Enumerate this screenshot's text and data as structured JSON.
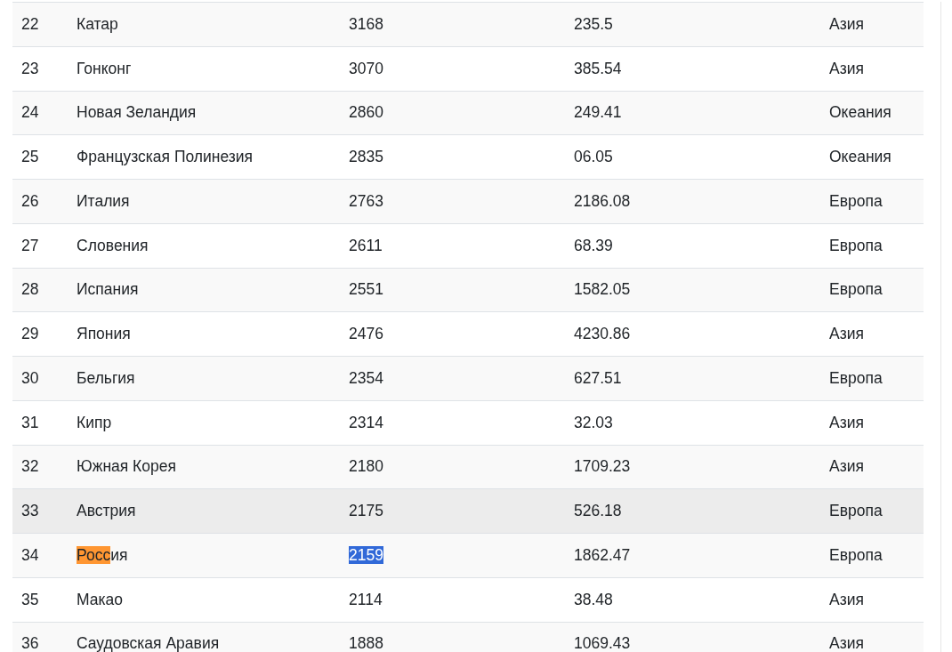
{
  "table": {
    "rows": [
      {
        "hovered": false,
        "cells": [
          "22",
          "Катар",
          "3168",
          "235.5",
          "Азия"
        ]
      },
      {
        "hovered": false,
        "cells": [
          "23",
          "Гонконг",
          "3070",
          "385.54",
          "Азия"
        ]
      },
      {
        "hovered": false,
        "cells": [
          "24",
          "Новая Зеландия",
          "2860",
          "249.41",
          "Океания"
        ]
      },
      {
        "hovered": false,
        "cells": [
          "25",
          "Французская Полинезия",
          "2835",
          "06.05",
          "Океания"
        ]
      },
      {
        "hovered": false,
        "cells": [
          "26",
          "Италия",
          "2763",
          "2186.08",
          "Европа"
        ]
      },
      {
        "hovered": false,
        "cells": [
          "27",
          "Словения",
          "2611",
          "68.39",
          "Европа"
        ]
      },
      {
        "hovered": false,
        "cells": [
          "28",
          "Испания",
          "2551",
          "1582.05",
          "Европа"
        ]
      },
      {
        "hovered": false,
        "cells": [
          "29",
          "Япония",
          "2476",
          "4230.86",
          "Азия"
        ]
      },
      {
        "hovered": false,
        "cells": [
          "30",
          "Бельгия",
          "2354",
          "627.51",
          "Европа"
        ]
      },
      {
        "hovered": false,
        "cells": [
          "31",
          "Кипр",
          "2314",
          "32.03",
          "Азия"
        ]
      },
      {
        "hovered": false,
        "cells": [
          "32",
          "Южная Корея",
          "2180",
          "1709.23",
          "Азия"
        ]
      },
      {
        "hovered": true,
        "cells": [
          "33",
          "Австрия",
          "2175",
          "526.18",
          "Европа"
        ]
      },
      {
        "hovered": false,
        "cells": [
          "34",
          {
            "parts": [
              {
                "text": "Росс",
                "highlighted": true
              },
              {
                "text": "ия",
                "highlighted": false
              }
            ]
          },
          {
            "text": "2159",
            "text_selected": true
          },
          "1862.47",
          "Европа"
        ]
      },
      {
        "hovered": false,
        "cells": [
          "35",
          "Макао",
          "2114",
          "38.48",
          "Азия"
        ]
      },
      {
        "hovered": false,
        "cells": [
          "36",
          "Саудовская Аравия",
          "1888",
          "1069.43",
          "Азия"
        ]
      }
    ]
  }
}
